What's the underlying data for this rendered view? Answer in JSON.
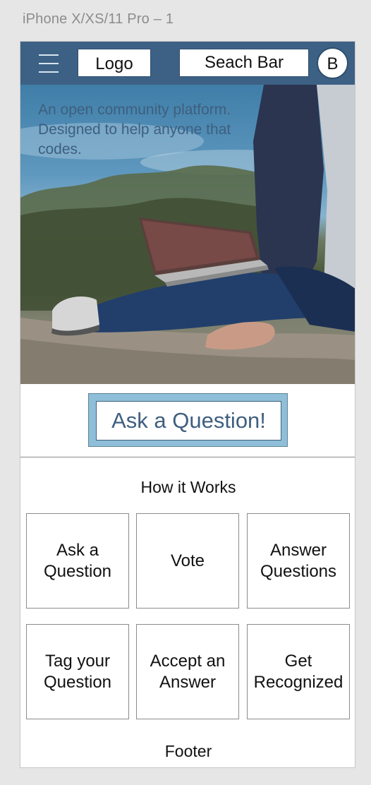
{
  "artboard": {
    "label": "iPhone X/XS/11 Pro – 1"
  },
  "navbar": {
    "menu_icon": "hamburger-menu-icon",
    "logo_label": "Logo",
    "search_label": "Seach Bar",
    "avatar_label": "B",
    "background_color": "#3d6185"
  },
  "hero": {
    "tagline": "An open community platform. Designed to help anyone that codes."
  },
  "cta": {
    "label": "Ask a Question!",
    "accent_color": "#8fbfd8"
  },
  "how_it_works": {
    "title": "How it Works",
    "cards": [
      {
        "label": "Ask a\nQuestion"
      },
      {
        "label": "Vote"
      },
      {
        "label": "Answer\nQuestions"
      },
      {
        "label": "Tag your\nQuestion"
      },
      {
        "label": "Accept an\nAnswer"
      },
      {
        "label": "Get\nRecognized"
      }
    ]
  },
  "footer": {
    "label": "Footer"
  }
}
